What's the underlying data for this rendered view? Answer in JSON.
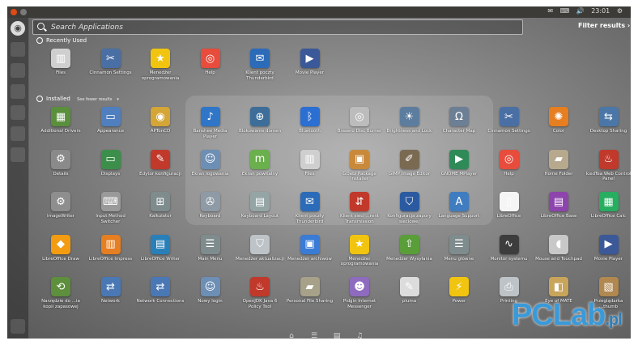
{
  "topbar": {
    "time": "23:01",
    "tray_icons": [
      "mail-icon",
      "keyboard-icon",
      "volume-icon"
    ]
  },
  "search": {
    "placeholder": "Search Applications",
    "filter_label": "Filter results"
  },
  "sections": {
    "recent": "Recently Used",
    "installed": "Installed",
    "see_fewer": "See fewer results"
  },
  "recent_apps": [
    {
      "label": "Files",
      "icon": "file-cabinet-icon",
      "color": "#cfcfcf"
    },
    {
      "label": "Cinnamon Settings",
      "icon": "tools-icon",
      "color": "#4a6fa5"
    },
    {
      "label": "Menedżer oprogramowania",
      "icon": "star-icon",
      "color": "#f1c40f"
    },
    {
      "label": "Help",
      "icon": "lifebuoy-icon",
      "color": "#e74c3c"
    },
    {
      "label": "Klient poczty Thunderbird",
      "icon": "thunderbird-icon",
      "color": "#2c6bb8"
    },
    {
      "label": "Movie Player",
      "icon": "film-icon",
      "color": "#3b5998"
    }
  ],
  "installed_apps": [
    {
      "label": "Additional Drivers",
      "icon": "chip-icon",
      "color": "#5a8f3c"
    },
    {
      "label": "Appearance",
      "icon": "monitor-icon",
      "color": "#4f7fbf"
    },
    {
      "label": "APTonCD",
      "icon": "cd-icon",
      "color": "#d4a537"
    },
    {
      "label": "Banshee Media Player",
      "icon": "banshee-icon",
      "color": "#2f76c8"
    },
    {
      "label": "Blokowanie domen",
      "icon": "globe-lock-icon",
      "color": "#3d6e99"
    },
    {
      "label": "Bluetooth",
      "icon": "bluetooth-icon",
      "color": "#2a6fd1"
    },
    {
      "label": "Brasero Disc Burner",
      "icon": "disc-icon",
      "color": "#bcbcbc"
    },
    {
      "label": "Brightness and Lock",
      "icon": "brightness-icon",
      "color": "#5d7d9e"
    },
    {
      "label": "Character Map",
      "icon": "charmap-icon",
      "color": "#6d7f95"
    },
    {
      "label": "Cinnamon Settings",
      "icon": "tools-icon",
      "color": "#4a6fa5"
    },
    {
      "label": "Color",
      "icon": "color-wheel-icon",
      "color": "#e67e22"
    },
    {
      "label": "Desktop Sharing",
      "icon": "desktop-share-icon",
      "color": "#4b77a8"
    },
    {
      "label": "Details",
      "icon": "gear-icon",
      "color": "#8a8a8a"
    },
    {
      "label": "Displays",
      "icon": "display-icon",
      "color": "#3c8f4a"
    },
    {
      "label": "Edytor konfiguracji",
      "icon": "config-editor-icon",
      "color": "#c0392b"
    },
    {
      "label": "Ekran logowania",
      "icon": "login-screen-icon",
      "color": "#6e8fb5"
    },
    {
      "label": "Ekran powitalny",
      "icon": "mint-logo-icon",
      "color": "#6ab04c"
    },
    {
      "label": "Files",
      "icon": "file-cabinet-icon",
      "color": "#cfcfcf"
    },
    {
      "label": "GDebi Package Installer",
      "icon": "package-icon",
      "color": "#c9893a"
    },
    {
      "label": "GIMP Image Editor",
      "icon": "gimp-icon",
      "color": "#7a6a52"
    },
    {
      "label": "GNOME MPlayer",
      "icon": "play-icon",
      "color": "#2e8b57"
    },
    {
      "label": "Help",
      "icon": "lifebuoy-icon",
      "color": "#e74c3c"
    },
    {
      "label": "Home Folder",
      "icon": "folder-icon",
      "color": "#b7a98e"
    },
    {
      "label": "IcedTea Web Control Panel",
      "icon": "java-icon",
      "color": "#c0392b"
    },
    {
      "label": "ImageWriter",
      "icon": "gears-icon",
      "color": "#8e8e8e"
    },
    {
      "label": "Input Method Switcher",
      "icon": "keyboard-icon",
      "color": "#9a9a9a"
    },
    {
      "label": "Kalkulator",
      "icon": "calculator-icon",
      "color": "#7f8c8d"
    },
    {
      "label": "Keyboard",
      "icon": "wrench-icon",
      "color": "#8e9aa5"
    },
    {
      "label": "Keyboard Layout",
      "icon": "layout-icon",
      "color": "#95a5a6"
    },
    {
      "label": "Klient poczty Thunderbird",
      "icon": "thunderbird-icon",
      "color": "#2c6bb8"
    },
    {
      "label": "Klient sieci ...rent Transmission",
      "icon": "transmission-icon",
      "color": "#c0392b"
    },
    {
      "label": "Konfiguracja zapory sieciowej",
      "icon": "shield-icon",
      "color": "#2c5aa0"
    },
    {
      "label": "Language Support",
      "icon": "language-icon",
      "color": "#3f7cc0"
    },
    {
      "label": "LibreOffice",
      "icon": "document-icon",
      "color": "#f5f5f5"
    },
    {
      "label": "LibreOffice Base",
      "icon": "lo-base-icon",
      "color": "#8e44ad"
    },
    {
      "label": "LibreOffice Calc",
      "icon": "lo-calc-icon",
      "color": "#27ae60"
    },
    {
      "label": "LibreOffice Draw",
      "icon": "lo-draw-icon",
      "color": "#f39c12"
    },
    {
      "label": "LibreOffice Impress",
      "icon": "lo-impress-icon",
      "color": "#e67e22"
    },
    {
      "label": "LibreOffice Writer",
      "icon": "lo-writer-icon",
      "color": "#2980b9"
    },
    {
      "label": "Main Menu",
      "icon": "menu-list-icon",
      "color": "#7f8c8d"
    },
    {
      "label": "Menedżer aktualizacji",
      "icon": "update-shield-icon",
      "color": "#bdc3c7"
    },
    {
      "label": "Menedżer archiwów",
      "icon": "archive-icon",
      "color": "#3a7bd5"
    },
    {
      "label": "Menedżer oprogramowania",
      "icon": "star-icon",
      "color": "#f1c40f"
    },
    {
      "label": "Menedżer Wysyłania",
      "icon": "upload-icon",
      "color": "#5a9e3a"
    },
    {
      "label": "Menu główne",
      "icon": "menu-list-icon",
      "color": "#7f8c8d"
    },
    {
      "label": "Monitor systemu",
      "icon": "system-monitor-icon",
      "color": "#3d3d3d"
    },
    {
      "label": "Mouse and Touchpad",
      "icon": "mouse-icon",
      "color": "#c8c8c8"
    },
    {
      "label": "Movie Player",
      "icon": "film-icon",
      "color": "#3b5998"
    },
    {
      "label": "Narzędzie do ...ia kopii zapasowej",
      "icon": "backup-icon",
      "color": "#5e8f3c"
    },
    {
      "label": "Network",
      "icon": "network-icon",
      "color": "#4a78b5"
    },
    {
      "label": "Network Connections",
      "icon": "network-icon",
      "color": "#4a78b5"
    },
    {
      "label": "Nowy login",
      "icon": "new-login-icon",
      "color": "#6e8fb5"
    },
    {
      "label": "OpenJDK Java 6 Policy Tool",
      "icon": "java-icon",
      "color": "#c0392b"
    },
    {
      "label": "Personal File Sharing",
      "icon": "folder-share-icon",
      "color": "#a7a18a"
    },
    {
      "label": "Pidgin Internet Messenger",
      "icon": "pidgin-icon",
      "color": "#8e6bbf"
    },
    {
      "label": "pluma",
      "icon": "text-editor-icon",
      "color": "#dcdcdc"
    },
    {
      "label": "Power",
      "icon": "power-icon",
      "color": "#f1c40f"
    },
    {
      "label": "Printing",
      "icon": "printer-icon",
      "color": "#bdc3c7"
    },
    {
      "label": "Eye of MATE",
      "icon": "image-viewer-icon",
      "color": "#c9a45b"
    },
    {
      "label": "Przeglądarka ...thumb",
      "icon": "photo-icon",
      "color": "#b08850"
    }
  ],
  "watermark": {
    "main": "PCLab",
    "tld": ".pl"
  },
  "dock": [
    "home-icon",
    "apps-icon",
    "files-icon",
    "music-icon",
    "video-icon"
  ]
}
